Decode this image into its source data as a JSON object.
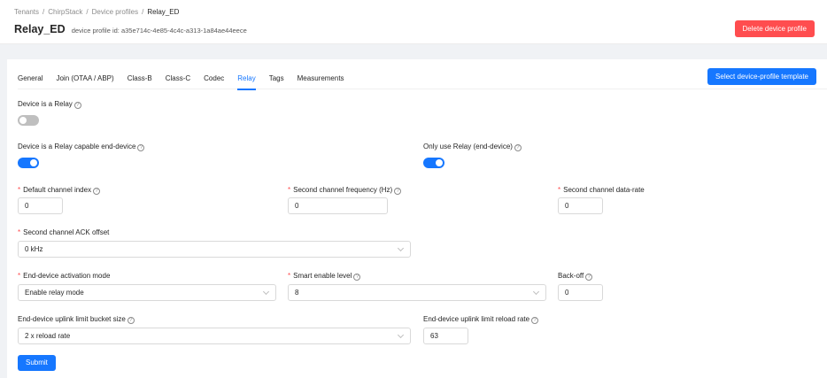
{
  "breadcrumb": [
    "Tenants",
    "ChirpStack",
    "Device profiles",
    "Relay_ED"
  ],
  "header": {
    "title": "Relay_ED",
    "subtitle": "device profile id: a35e714c-4e85-4c4c-a313-1a84ae44eece",
    "delete_label": "Delete device profile"
  },
  "tabs": [
    "General",
    "Join (OTAA / ABP)",
    "Class-B",
    "Class-C",
    "Codec",
    "Relay",
    "Tags",
    "Measurements"
  ],
  "active_tab": "Relay",
  "template_button": "Select device-profile template",
  "form": {
    "is_relay": {
      "label": "Device is a Relay",
      "on": false
    },
    "relay_capable": {
      "label": "Device is a Relay capable end-device",
      "on": true
    },
    "only_relay": {
      "label": "Only use Relay (end-device)",
      "on": true
    },
    "default_channel_index": {
      "label": "Default channel index",
      "value": "0"
    },
    "second_channel_freq": {
      "label": "Second channel frequency (Hz)",
      "value": "0"
    },
    "second_channel_dr": {
      "label": "Second channel data-rate",
      "value": "0"
    },
    "second_channel_ack": {
      "label": "Second channel ACK offset",
      "value": "0 kHz"
    },
    "activation_mode": {
      "label": "End-device activation mode",
      "value": "Enable relay mode"
    },
    "smart_enable": {
      "label": "Smart enable level",
      "value": "8"
    },
    "backoff": {
      "label": "Back-off",
      "value": "0"
    },
    "bucket_size": {
      "label": "End-device uplink limit bucket size",
      "value": "2 x reload rate"
    },
    "reload_rate": {
      "label": "End-device uplink limit reload rate",
      "value": "63"
    }
  },
  "submit_label": "Submit",
  "colors": {
    "primary": "#1677ff",
    "danger": "#ff4d4f",
    "required": "#ff4d4f"
  }
}
